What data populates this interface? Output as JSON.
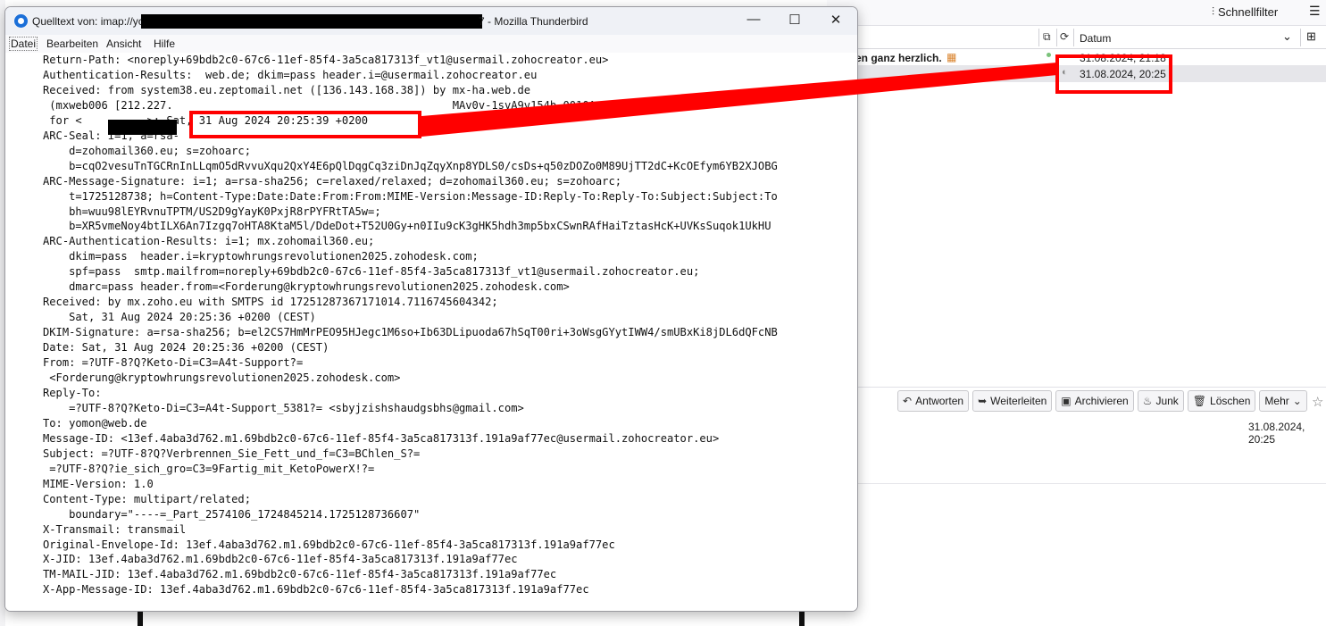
{
  "background_app": {
    "toolbar": {
      "quick_filter_label": "Schnellfilter"
    },
    "message_list": {
      "column_date_label": "Datum",
      "rows": [
        {
          "subject": "en ganz herzlich.",
          "date": "31.08.2024, 21:18"
        },
        {
          "subject": "",
          "date": "31.08.2024, 20:25"
        }
      ]
    },
    "message_header": {
      "actions": [
        "Antworten",
        "Weiterleiten",
        "Archivieren",
        "Junk",
        "Löschen",
        "Mehr"
      ],
      "date": "31.08.2024, 20:25"
    }
  },
  "source_window": {
    "title_prefix": "Quelltext von: imap://yc",
    "title_suffix": "7 - Mozilla Thunderbird",
    "menu": [
      "Datei",
      "Bearbeiten",
      "Ansicht",
      "Hilfe"
    ],
    "source_text": "Return-Path: <noreply+69bdb2c0-67c6-11ef-85f4-3a5ca817313f_vt1@usermail.zohocreator.eu>\nAuthentication-Results:  web.de; dkim=pass header.i=@usermail.zohocreator.eu\nReceived: from system38.eu.zeptomail.net ([136.143.168.38]) by mx-ha.web.de\n (mxweb006 [212.227.                                           MAv0v-1svA9v154b-0010A\n for <          >; Sat, 31 Aug 2024 20:25:39 +0200\nARC-Seal: i=1; a=rsa-\n    d=zohomail360.eu; s=zohoarc;\n    b=cqO2vesuTnTGCRnInLLqmO5dRvvuXqu2QxY4E6pQlDqgCq3ziDnJqZqyXnp8YDLS0/csDs+q50zDOZo0M89UjTT2dC+KcOEfym6YB2XJOBG\nARC-Message-Signature: i=1; a=rsa-sha256; c=relaxed/relaxed; d=zohomail360.eu; s=zohoarc;\n    t=1725128738; h=Content-Type:Date:Date:From:From:MIME-Version:Message-ID:Reply-To:Reply-To:Subject:Subject:To\n    bh=wuu98lEYRvnuTPTM/US2D9gYayK0PxjR8rPYFRtTA5w=;\n    b=XR5vmeNoy4btILX6An7Izgq7oHTA8KtaM5l/DdeDot+T52U0Gy+n0IIu9cK3gHK5hdh3mp5bxCSwnRAfHaiTztasHcK+UVKsSuqok1UkHU\nARC-Authentication-Results: i=1; mx.zohomail360.eu;\n    dkim=pass  header.i=kryptowhrungsrevolutionen2025.zohodesk.com;\n    spf=pass  smtp.mailfrom=noreply+69bdb2c0-67c6-11ef-85f4-3a5ca817313f_vt1@usermail.zohocreator.eu;\n    dmarc=pass header.from=<Forderung@kryptowhrungsrevolutionen2025.zohodesk.com>\nReceived: by mx.zoho.eu with SMTPS id 17251287367171014.7116745604342;\n    Sat, 31 Aug 2024 20:25:36 +0200 (CEST)\nDKIM-Signature: a=rsa-sha256; b=el2CS7HmMrPEO95HJegc1M6so+Ib63DLipuoda67hSqT00ri+3oWsgGYytIWW4/smUBxKi8jDL6dQFcNB\nDate: Sat, 31 Aug 2024 20:25:36 +0200 (CEST)\nFrom: =?UTF-8?Q?Keto-Di=C3=A4t-Support?=\n <Forderung@kryptowhrungsrevolutionen2025.zohodesk.com>\nReply-To:\n    =?UTF-8?Q?Keto-Di=C3=A4t-Support_5381?= <sbyjzishshaudgsbhs@gmail.com>\nTo: yomon@web.de\nMessage-ID: <13ef.4aba3d762.m1.69bdb2c0-67c6-11ef-85f4-3a5ca817313f.191a9af77ec@usermail.zohocreator.eu>\nSubject: =?UTF-8?Q?Verbrennen_Sie_Fett_und_f=C3=BChlen_S?=\n =?UTF-8?Q?ie_sich_gro=C3=9Fartig_mit_KetoPowerX!?=\nMIME-Version: 1.0\nContent-Type: multipart/related;\n    boundary=\"----=_Part_2574106_1724845214.1725128736607\"\nX-Transmail: transmail\nOriginal-Envelope-Id: 13ef.4aba3d762.m1.69bdb2c0-67c6-11ef-85f4-3a5ca817313f.191a9af77ec\nX-JID: 13ef.4aba3d762.m1.69bdb2c0-67c6-11ef-85f4-3a5ca817313f.191a9af77ec\nTM-MAIL-JID: 13ef.4aba3d762.m1.69bdb2c0-67c6-11ef-85f4-3a5ca817313f.191a9af77ec\nX-App-Message-ID: 13ef.4aba3d762.m1.69bdb2c0-67c6-11ef-85f4-3a5ca817313f.191a9af77ec"
  },
  "icons": {
    "filter": "filter-icon",
    "menu": "hamburger-icon",
    "star": "star-icon",
    "reply": "reply-icon",
    "forward": "forward-icon",
    "archive": "archive-icon",
    "junk": "junk-icon",
    "delete": "trash-icon",
    "more": "chevron-down-icon"
  },
  "colors": {
    "annotation": "#ff0000",
    "selected_row": "#e6e6ea",
    "app_icon": "#1b6fd8"
  }
}
